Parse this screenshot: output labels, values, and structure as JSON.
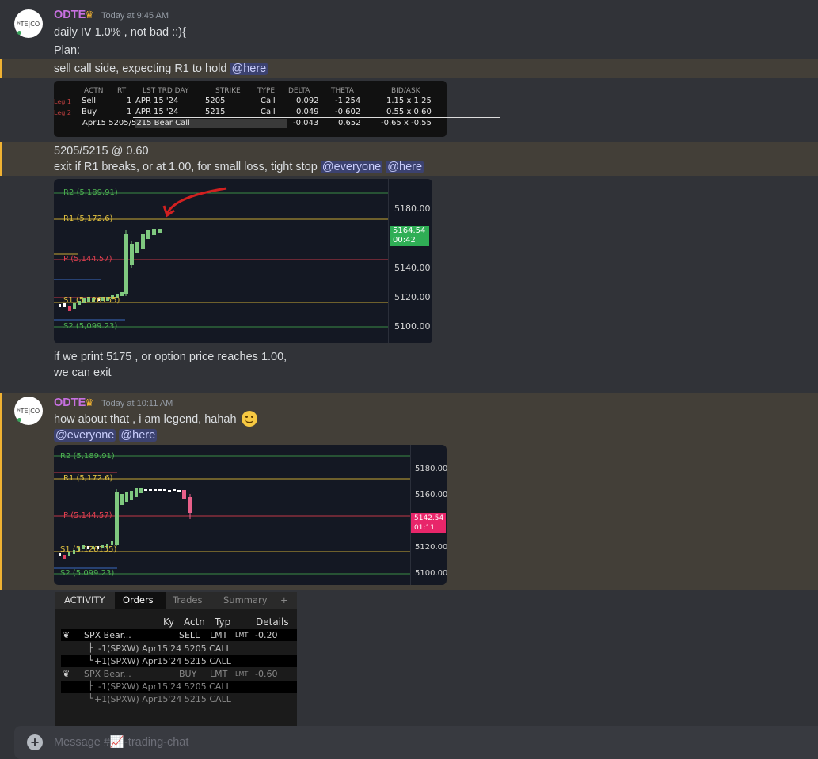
{
  "messages": [
    {
      "username": "ODTE",
      "timestamp": "Today at 9:45 AM",
      "lines": [
        "daily IV 1.0% , not bad ::){",
        "Plan:",
        "sell call side, expecting R1 to hold",
        "5205/5215 @ 0.60",
        "exit if R1 breaks, or at 1.00, for small loss, tight stop",
        "if we print 5175 , or option price reaches 1.00,",
        "we can exit"
      ],
      "mentions": {
        "here": "@here",
        "everyone": "@everyone"
      }
    },
    {
      "username": "ODTE",
      "timestamp": "Today at 10:11 AM",
      "lines": [
        "how about that , i am legend, hahah"
      ]
    }
  ],
  "avatar_text": "ᴺTE|CO",
  "option_table": {
    "headers": [
      "ACTN",
      "RT",
      "LST TRD DAY",
      "STRIKE",
      "TYPE",
      "DELTA",
      "THETA",
      "BID/ASK"
    ],
    "rows": [
      {
        "leg": "Leg 1",
        "actn": "Sell",
        "rt": "1",
        "day": "APR 15 '24",
        "strike": "5205",
        "type": "Call",
        "delta": "0.092",
        "theta": "-1.254",
        "bidask": "1.15 x 1.25"
      },
      {
        "leg": "Leg 2",
        "actn": "Buy",
        "rt": "1",
        "day": "APR 15 '24",
        "strike": "5215",
        "type": "Call",
        "delta": "0.049",
        "theta": "-0.602",
        "bidask": "0.55 x 0.60"
      }
    ],
    "summary": {
      "label": "Apr15 5205/5215 Bear Call",
      "delta": "-0.043",
      "theta": "0.652",
      "bidask": "-0.65 x -0.55"
    }
  },
  "charts": [
    {
      "pivots": [
        {
          "label": "R2 (5,189.91)",
          "color": "#4caf50"
        },
        {
          "label": "R1 (5,172.6)",
          "color": "#e0c040"
        },
        {
          "label": "P (5,144.57)",
          "color": "#e04050"
        },
        {
          "label": "S1 (5,126155)",
          "color": "#e0c040"
        },
        {
          "label": "S2 (5,099.23)",
          "color": "#4caf50"
        }
      ],
      "y_labels": [
        "5180.00",
        "5140.00",
        "5120.00",
        "5100.00"
      ],
      "price": "5164.54",
      "countdown": "00:42",
      "price_color": "#2fae55"
    },
    {
      "pivots": [
        {
          "label": "R2 (5,189.91)",
          "color": "#4caf50"
        },
        {
          "label": "R1 (5,172.6)",
          "color": "#e0c040"
        },
        {
          "label": "P (5,144.57)",
          "color": "#e04050"
        },
        {
          "label": "S1 (5,126155)",
          "color": "#e0c040"
        },
        {
          "label": "S2 (5,099.23)",
          "color": "#4caf50"
        }
      ],
      "y_labels": [
        "5180.00",
        "5160.00",
        "5120.00",
        "5100.00"
      ],
      "price": "5142.54",
      "countdown": "01:11",
      "price_color": "#e8266a"
    }
  ],
  "activity": {
    "tabs": [
      "ACTIVITY",
      "Orders",
      "Trades",
      "Summary",
      "+"
    ],
    "headers": [
      "Ky",
      "Actn",
      "Typ",
      "Details"
    ],
    "orders": [
      {
        "name": "SPX Bear...",
        "actn": "SELL",
        "typ": "LMT",
        "lmt": "LMT",
        "price": "-0.20",
        "legs": [
          "-1(SPXW) Apr15'24 5205 CALL",
          "+1(SPXW) Apr15'24 5215 CALL"
        ]
      },
      {
        "name": "SPX Bear...",
        "actn": "BUY",
        "typ": "LMT",
        "lmt": "LMT",
        "price": "-0.60",
        "legs": [
          "-1(SPXW) Apr15'24 5205 CALL",
          "+1(SPXW) Apr15'24 5215 CALL"
        ]
      }
    ]
  },
  "composer": {
    "placeholder": "Message #📈-trading-chat"
  }
}
